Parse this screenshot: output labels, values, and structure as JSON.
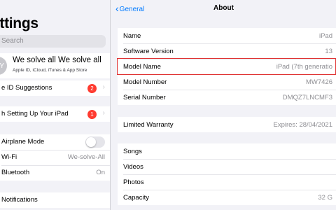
{
  "sidebar": {
    "title": "ettings",
    "search_placeholder": "Search",
    "profile": {
      "avatar_initials": "WY",
      "name": "We solve all We solve all",
      "subtitle": "Apple ID, iCloud, iTunes & App Store"
    },
    "rows": [
      {
        "label": "e ID Suggestions",
        "badge": "2"
      },
      {
        "label": "h Setting Up Your iPad",
        "badge": "1"
      },
      {
        "label": "Airplane Mode",
        "toggle": "off"
      },
      {
        "label": "Wi-Fi",
        "value": "We-solve-All"
      },
      {
        "label": "Bluetooth",
        "value": "On"
      },
      {
        "label": "Notifications"
      }
    ]
  },
  "main": {
    "back_label": "General",
    "title": "About",
    "group1": [
      {
        "label": "Name",
        "value": "iPad"
      },
      {
        "label": "Software Version",
        "value": "13"
      },
      {
        "label": "Model Name",
        "value": "iPad (7th generatio"
      },
      {
        "label": "Model Number",
        "value": "MW7426"
      },
      {
        "label": "Serial Number",
        "value": "DMQZ7LNCMF3"
      }
    ],
    "group2": [
      {
        "label": "Limited Warranty",
        "value": "Expires: 28/04/2021"
      }
    ],
    "group3": [
      {
        "label": "Songs",
        "value": ""
      },
      {
        "label": "Videos",
        "value": ""
      },
      {
        "label": "Photos",
        "value": ""
      },
      {
        "label": "Capacity",
        "value": "32 G"
      }
    ]
  },
  "colors": {
    "accent": "#007aff",
    "badge": "#ff3b30",
    "highlight": "#e03232"
  }
}
